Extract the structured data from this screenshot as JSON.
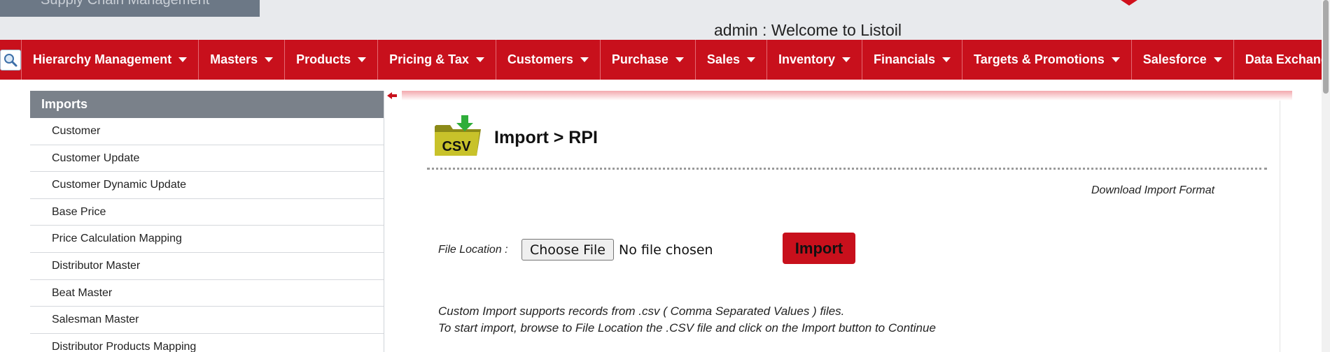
{
  "header": {
    "logo_text": "Supply Chain Management",
    "welcome_text": "admin : Welcome to Listoil"
  },
  "nav": {
    "search_icon": "search-icon",
    "items": [
      {
        "label": "Hierarchy Management"
      },
      {
        "label": "Masters"
      },
      {
        "label": "Products"
      },
      {
        "label": "Pricing & Tax"
      },
      {
        "label": "Customers"
      },
      {
        "label": "Purchase"
      },
      {
        "label": "Sales"
      },
      {
        "label": "Inventory"
      },
      {
        "label": "Financials"
      },
      {
        "label": "Targets & Promotions"
      },
      {
        "label": "Salesforce"
      },
      {
        "label": "Data Exchange"
      }
    ]
  },
  "sidebar": {
    "title": "Imports",
    "items": [
      {
        "label": "Customer"
      },
      {
        "label": "Customer Update"
      },
      {
        "label": "Customer Dynamic Update"
      },
      {
        "label": "Base Price"
      },
      {
        "label": "Price Calculation Mapping"
      },
      {
        "label": "Distributor Master"
      },
      {
        "label": "Beat Master"
      },
      {
        "label": "Salesman Master"
      },
      {
        "label": "Distributor Products Mapping"
      }
    ]
  },
  "main": {
    "title": "Import  > RPI",
    "csv_icon_text": "CSV",
    "download_link": "Download Import Format",
    "file_location_label": "File Location   :",
    "choose_file_label": "Choose File",
    "no_file_text": "No file chosen",
    "import_button": "Import",
    "help_line_1": "Custom Import supports records from .csv ( Comma Separated Values ) files.",
    "help_line_2": "To start import, browse to File Location the .CSV file and click on the Import button to Continue"
  },
  "colors": {
    "brand_red": "#c8101c",
    "sidebar_header": "#7a818a",
    "header_bg": "#e8eaed"
  }
}
